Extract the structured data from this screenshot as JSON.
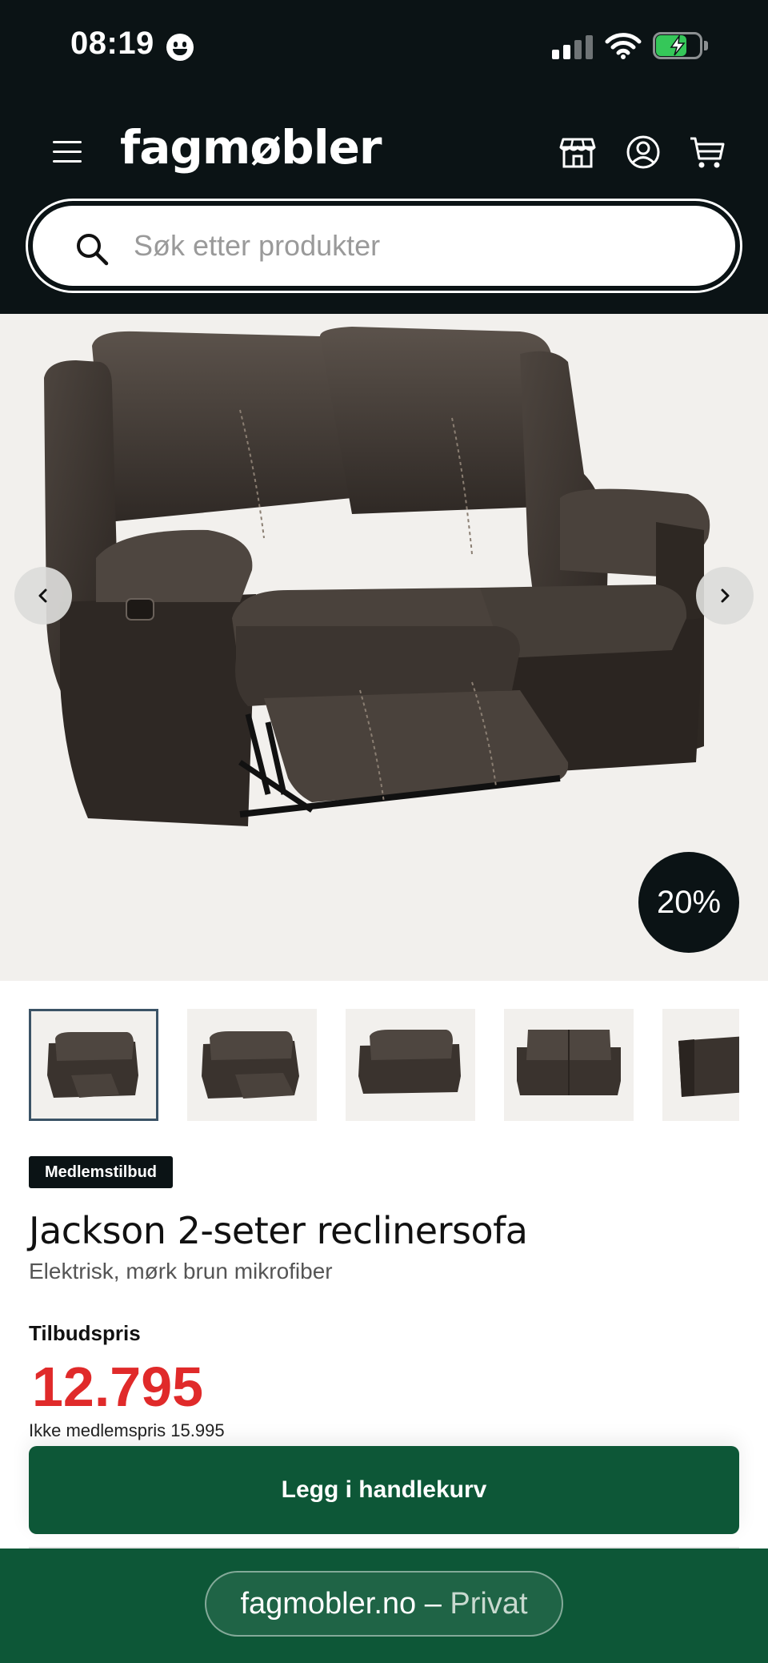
{
  "status_bar": {
    "time": "08:19",
    "icons": [
      "smiley-face-icon",
      "cellular-signal-icon",
      "wifi-icon",
      "battery-charging-icon"
    ],
    "battery_color": "#35c759"
  },
  "header": {
    "logo": "fagmøbler",
    "icons": [
      "hamburger-menu-icon",
      "store-icon",
      "user-account-icon",
      "shopping-cart-icon"
    ]
  },
  "search": {
    "placeholder": "Søk etter produkter",
    "value": ""
  },
  "gallery": {
    "discount_badge": "20%",
    "thumbnail_count_visible": 5,
    "active_thumbnail": 1
  },
  "product": {
    "badge": "Medlemstilbud",
    "title": "Jackson 2-seter reclinersofa",
    "subtitle": "Elektrisk, mørk brun mikrofiber",
    "price_label": "Tilbudspris",
    "price": "12.795",
    "member_price_text": "Ikke medlemspris 15.995",
    "add_to_cart_label": "Legg i handlekurv"
  },
  "browser": {
    "domain": "fagmobler.no",
    "separator": "–",
    "context": "Privat"
  },
  "colors": {
    "header_bg": "#0b1315",
    "price_red": "#e02a2a",
    "brand_green": "#0d5737",
    "hero_bg": "#f2f0ed"
  }
}
